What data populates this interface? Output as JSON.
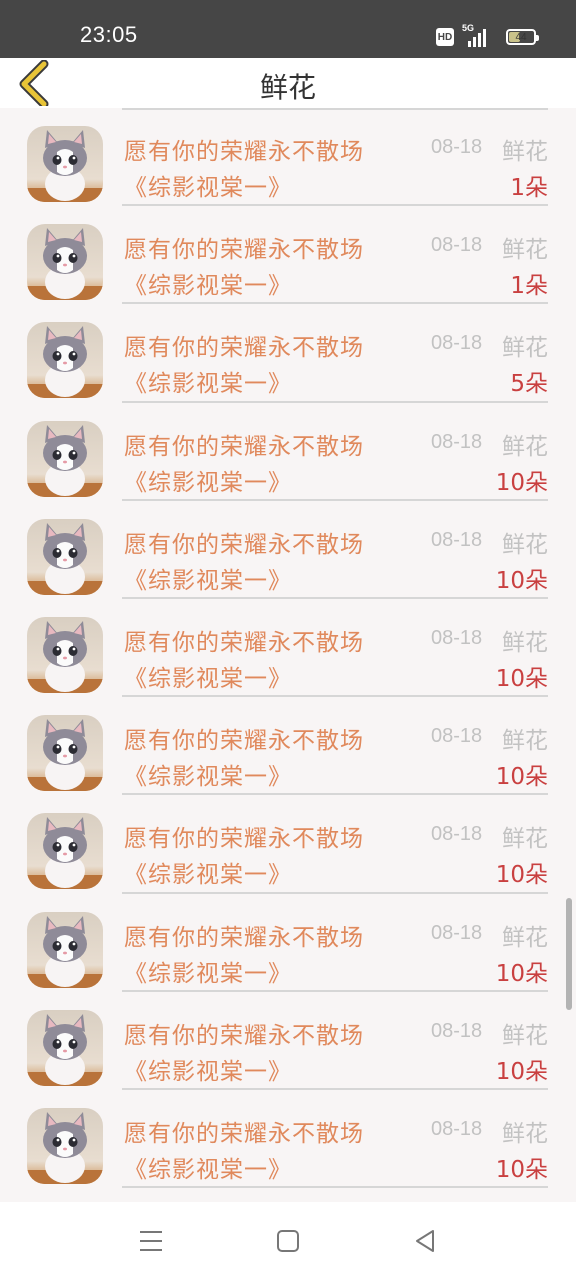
{
  "status_bar": {
    "time": "23:05",
    "hd": "HD",
    "network": "5G",
    "battery": "44"
  },
  "header": {
    "title": "鲜花"
  },
  "items": [
    {
      "title": "愿有你的荣耀永不散场",
      "subtitle": "《综影视棠一》",
      "date": "08-18",
      "type": "鲜花",
      "count": "1朵"
    },
    {
      "title": "愿有你的荣耀永不散场",
      "subtitle": "《综影视棠一》",
      "date": "08-18",
      "type": "鲜花",
      "count": "1朵"
    },
    {
      "title": "愿有你的荣耀永不散场",
      "subtitle": "《综影视棠一》",
      "date": "08-18",
      "type": "鲜花",
      "count": "5朵"
    },
    {
      "title": "愿有你的荣耀永不散场",
      "subtitle": "《综影视棠一》",
      "date": "08-18",
      "type": "鲜花",
      "count": "10朵"
    },
    {
      "title": "愿有你的荣耀永不散场",
      "subtitle": "《综影视棠一》",
      "date": "08-18",
      "type": "鲜花",
      "count": "10朵"
    },
    {
      "title": "愿有你的荣耀永不散场",
      "subtitle": "《综影视棠一》",
      "date": "08-18",
      "type": "鲜花",
      "count": "10朵"
    },
    {
      "title": "愿有你的荣耀永不散场",
      "subtitle": "《综影视棠一》",
      "date": "08-18",
      "type": "鲜花",
      "count": "10朵"
    },
    {
      "title": "愿有你的荣耀永不散场",
      "subtitle": "《综影视棠一》",
      "date": "08-18",
      "type": "鲜花",
      "count": "10朵"
    },
    {
      "title": "愿有你的荣耀永不散场",
      "subtitle": "《综影视棠一》",
      "date": "08-18",
      "type": "鲜花",
      "count": "10朵"
    },
    {
      "title": "愿有你的荣耀永不散场",
      "subtitle": "《综影视棠一》",
      "date": "08-18",
      "type": "鲜花",
      "count": "10朵"
    },
    {
      "title": "愿有你的荣耀永不散场",
      "subtitle": "《综影视棠一》",
      "date": "08-18",
      "type": "鲜花",
      "count": "10朵"
    }
  ],
  "icons": {
    "back": "chevron-left-icon",
    "avatar": "cat-avatar",
    "nav_menu": "menu-icon",
    "nav_home": "square-home-icon",
    "nav_back": "triangle-back-icon"
  },
  "colors": {
    "title_orange": "#e0895c",
    "count_red": "#c94040",
    "meta_gray": "#c2c2c2",
    "back_chevron": "#e8c437"
  }
}
